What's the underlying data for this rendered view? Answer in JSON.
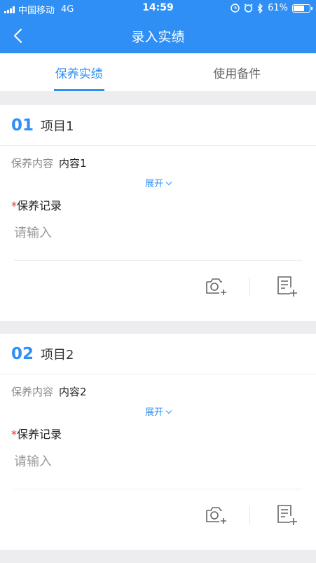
{
  "status_bar": {
    "carrier": "中国移动",
    "network": "4G",
    "time": "14:59",
    "battery": "61%",
    "battery_level": 0.61
  },
  "nav": {
    "title": "录入实绩"
  },
  "tabs": [
    {
      "label": "保养实绩",
      "active": true
    },
    {
      "label": "使用备件",
      "active": false
    }
  ],
  "cards": [
    {
      "number": "01",
      "name": "项目1",
      "content_label": "保养内容",
      "content_value": "内容1",
      "expand_label": "展开",
      "required_mark": "*",
      "record_label": "保养记录",
      "record_placeholder": "请输入"
    },
    {
      "number": "02",
      "name": "项目2",
      "content_label": "保养内容",
      "content_value": "内容2",
      "expand_label": "展开",
      "required_mark": "*",
      "record_label": "保养记录",
      "record_placeholder": "请输入"
    }
  ],
  "colors": {
    "accent": "#2f8ff5",
    "required": "#e0363a",
    "background": "#ededf0"
  },
  "icons": [
    "signal-icon",
    "alarm-icon",
    "clock-icon",
    "bluetooth-icon",
    "battery-icon",
    "back-arrow-icon",
    "camera-add-icon",
    "note-add-icon",
    "chevron-down-icon"
  ]
}
